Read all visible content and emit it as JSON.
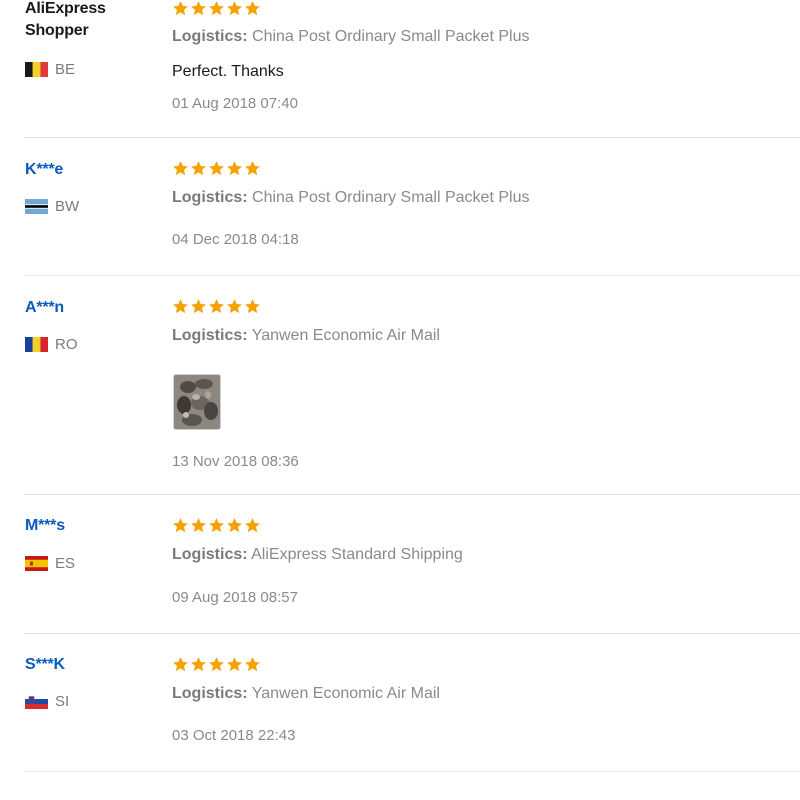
{
  "reviews": [
    {
      "user": "AliExpress Shopper",
      "country_code": "BE",
      "flag_icon": "belgium-flag-icon",
      "rating": 5,
      "logistics_label": "Logistics:",
      "logistics_value": "China Post Ordinary Small Packet Plus",
      "comment": "Perfect. Thanks",
      "date": "01 Aug 2018 07:40"
    },
    {
      "user": "K***e",
      "country_code": "BW",
      "flag_icon": "botswana-flag-icon",
      "rating": 5,
      "logistics_label": "Logistics:",
      "logistics_value": "China Post Ordinary Small Packet Plus",
      "date": "04 Dec 2018 04:18"
    },
    {
      "user": "A***n",
      "country_code": "RO",
      "flag_icon": "romania-flag-icon",
      "rating": 5,
      "logistics_label": "Logistics:",
      "logistics_value": "Yanwen Economic Air Mail",
      "photo_icon": "review-photo-thumbnail",
      "date": "13 Nov 2018 08:36"
    },
    {
      "user": "M***s",
      "country_code": "ES",
      "flag_icon": "spain-flag-icon",
      "rating": 5,
      "logistics_label": "Logistics:",
      "logistics_value": "AliExpress Standard Shipping",
      "date": "09 Aug 2018 08:57"
    },
    {
      "user": "S***K",
      "country_code": "SI",
      "flag_icon": "slovenia-flag-icon",
      "rating": 5,
      "logistics_label": "Logistics:",
      "logistics_value": "Yanwen Economic Air Mail",
      "date": "03 Oct 2018 22:43"
    }
  ],
  "colors": {
    "star": "#f5a100",
    "username": "#0a5ac0",
    "muted_text": "#8a8a8a",
    "divider": "#e3e3e3"
  }
}
